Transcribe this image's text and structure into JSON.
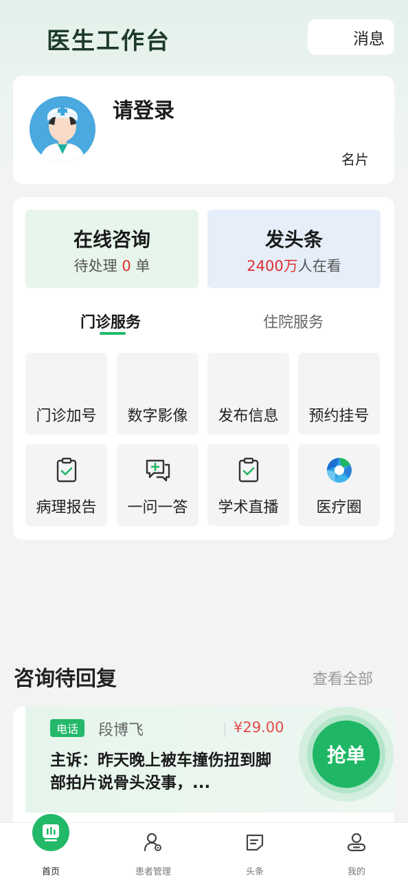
{
  "header": {
    "title": "医生工作台",
    "message_label": "消息"
  },
  "profile": {
    "login_text": "请登录",
    "card_link": "名片"
  },
  "quick": {
    "consult": {
      "title": "在线咨询",
      "sub_prefix": "待处理 ",
      "pending_count": "0",
      "sub_suffix": " 单"
    },
    "news": {
      "title": "发头条",
      "viewers": "2400万",
      "sub_suffix": "人在看"
    }
  },
  "tabs": [
    {
      "label": "门诊服务",
      "active": true
    },
    {
      "label": "住院服务",
      "active": false
    }
  ],
  "grid": [
    {
      "label": "门诊加号",
      "icon": "none"
    },
    {
      "label": "数字影像",
      "icon": "none"
    },
    {
      "label": "发布信息",
      "icon": "none"
    },
    {
      "label": "预约挂号",
      "icon": "none"
    },
    {
      "label": "病理报告",
      "icon": "clipboard-check-icon"
    },
    {
      "label": "一问一答",
      "icon": "chat-plus-icon"
    },
    {
      "label": "学术直播",
      "icon": "clipboard-check-icon"
    },
    {
      "label": "医疗圈",
      "icon": "camera-lens-icon"
    }
  ],
  "pending": {
    "title": "咨询待回复",
    "view_all": "查看全部",
    "order": {
      "type_tag": "电话",
      "patient": "段博飞",
      "price": "¥29.00",
      "complaint": "主诉：昨天晚上被车撞伤扭到脚部拍片说骨头没事，...",
      "action": "抢单"
    }
  },
  "tabbar": [
    {
      "label": "首页",
      "icon": "chart-icon",
      "active": true
    },
    {
      "label": "患者管理",
      "icon": "patient-manage-icon",
      "active": false
    },
    {
      "label": "头条",
      "icon": "news-icon",
      "active": false
    },
    {
      "label": "我的",
      "icon": "profile-icon",
      "active": false
    }
  ],
  "colors": {
    "accent": "#1fb765",
    "price_red": "#e24a4a",
    "highlight_red": "#e02d2d"
  }
}
